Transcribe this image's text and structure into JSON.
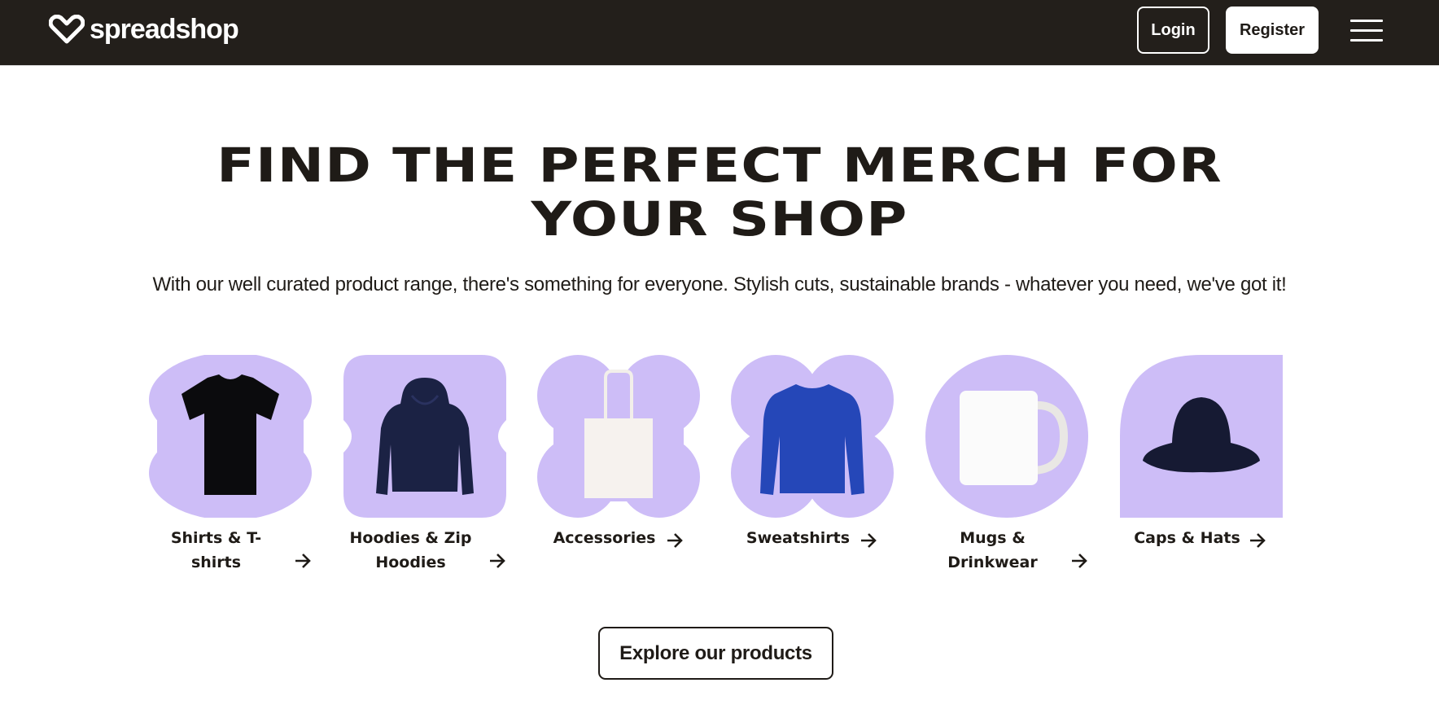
{
  "header": {
    "brand_name": "spreadshop",
    "login_label": "Login",
    "register_label": "Register",
    "menu_icon": "hamburger-menu-icon"
  },
  "hero": {
    "title_line1": "FIND THE PERFECT MERCH FOR",
    "title_line2": "YOUR SHOP",
    "subtitle": "With our well curated product range, there's something for everyone. Stylish cuts, sustainable brands - whatever you need, we've got it!"
  },
  "categories": [
    {
      "label_line1": "Shirts & T-",
      "label_line2": "shirts",
      "icon": "t-shirt-icon"
    },
    {
      "label_line1": "Hoodies & Zip",
      "label_line2": "Hoodies",
      "icon": "hoodie-icon"
    },
    {
      "label_line1": "Accessories",
      "label_line2": "",
      "icon": "tote-bag-icon"
    },
    {
      "label_line1": "Sweatshirts",
      "label_line2": "",
      "icon": "sweatshirt-icon"
    },
    {
      "label_line1": "Mugs &",
      "label_line2": "Drinkwear",
      "icon": "mug-icon"
    },
    {
      "label_line1": "Caps & Hats",
      "label_line2": "",
      "icon": "bucket-hat-icon"
    }
  ],
  "explore_label": "Explore our products",
  "colors": {
    "header_bg": "#231f1b",
    "lavender": "#cdbdf7",
    "text": "#1f1b17"
  }
}
